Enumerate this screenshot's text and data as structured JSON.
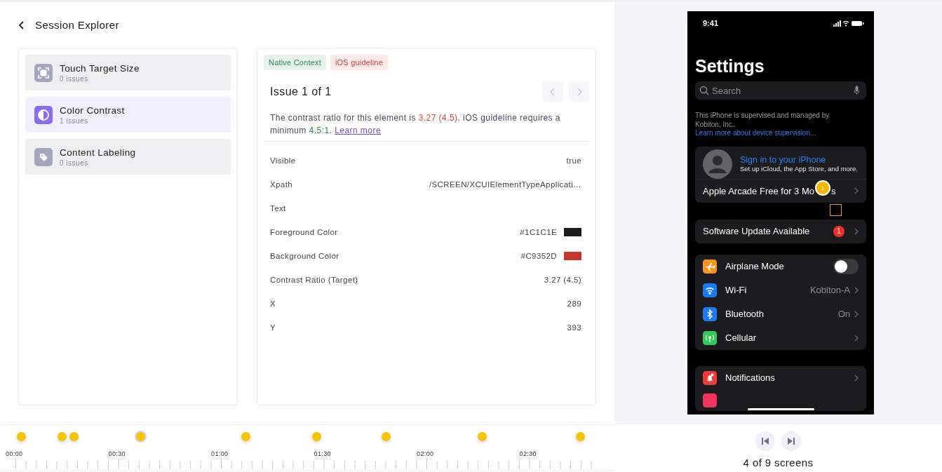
{
  "header": {
    "title": "Session Explorer"
  },
  "categories": [
    {
      "name": "Touch Target Size",
      "count": "0 issues",
      "selected": false
    },
    {
      "name": "Color Contrast",
      "count": "1 issues",
      "selected": true
    },
    {
      "name": "Content Labeling",
      "count": "0 issues",
      "selected": false
    }
  ],
  "issue": {
    "tags": [
      {
        "label": "Native Context",
        "color": "#2e8a5a"
      },
      {
        "label": "iOS guideline",
        "color": "#e0403a"
      }
    ],
    "title": "Issue 1 of 1",
    "description": [
      {
        "kind": "plain",
        "text": "The contrast ratio for this element is "
      },
      {
        "kind": "bad",
        "text": "3.27 (4.5)"
      },
      {
        "kind": "plain",
        "text": ". iOS guideline requires a minimum "
      },
      {
        "kind": "good",
        "text": "4.5:1"
      },
      {
        "kind": "plain",
        "text": ". "
      },
      {
        "kind": "link",
        "text": "Learn more"
      }
    ],
    "details": [
      {
        "label": "Visible",
        "value": "true"
      },
      {
        "label": "Xpath",
        "value": "/SCREEN/XCUIElementTypeApplicati…"
      },
      {
        "label": "Text"
      },
      {
        "label": "Foreground Color",
        "value": "#1C1C1E",
        "color": "#1c1c1e"
      },
      {
        "label": "Background Color",
        "value": "#C9352D",
        "color": "#c9352d"
      },
      {
        "label": "Contrast Ratio (Target)",
        "value": "3.27 (4.5)"
      },
      {
        "label": "X",
        "value": "289"
      },
      {
        "label": "Y",
        "value": "393"
      }
    ]
  },
  "timeline": {
    "labels": [
      "00:00",
      "00:30",
      "01:00",
      "01:30",
      "02:00",
      "02:30"
    ],
    "markers": [
      {
        "selected": false
      },
      {
        "selected": false
      },
      {
        "selected": false
      },
      {
        "selected": true
      },
      {
        "selected": false
      },
      {
        "selected": false
      },
      {
        "selected": false
      },
      {
        "selected": false
      },
      {
        "selected": false
      }
    ]
  },
  "phone": {
    "time": "9:41",
    "title": "Settings",
    "search_placeholder": "Search",
    "supervision": {
      "text": "This iPhone is supervised and managed by Kobiton, Inc.. ",
      "link": "Learn more about device supervision..."
    },
    "account": {
      "title": "Sign in to your iPhone",
      "subtitle": "Set up iCloud, the App Store, and more.",
      "offer_start": "Apple Arcade Free for 3 Mo",
      "offer_end": "s",
      "marker": "1"
    },
    "update": {
      "label": "Software Update Available",
      "badge": "1"
    },
    "network": [
      {
        "kind": "toggle",
        "label": "Airplane Mode",
        "color": "#f7951d",
        "on": false
      },
      {
        "kind": "link",
        "label": "Wi-Fi",
        "value": "Kobiton-A",
        "color": "#1a7cf5"
      },
      {
        "kind": "link",
        "label": "Bluetooth",
        "value": "On",
        "color": "#1a7cf5"
      },
      {
        "kind": "link",
        "label": "Cellular",
        "color": "#34c759"
      }
    ],
    "more": [
      {
        "label": "Notifications",
        "color": "#f03a3a"
      }
    ]
  },
  "screens": {
    "status": "4 of 9 screens"
  }
}
